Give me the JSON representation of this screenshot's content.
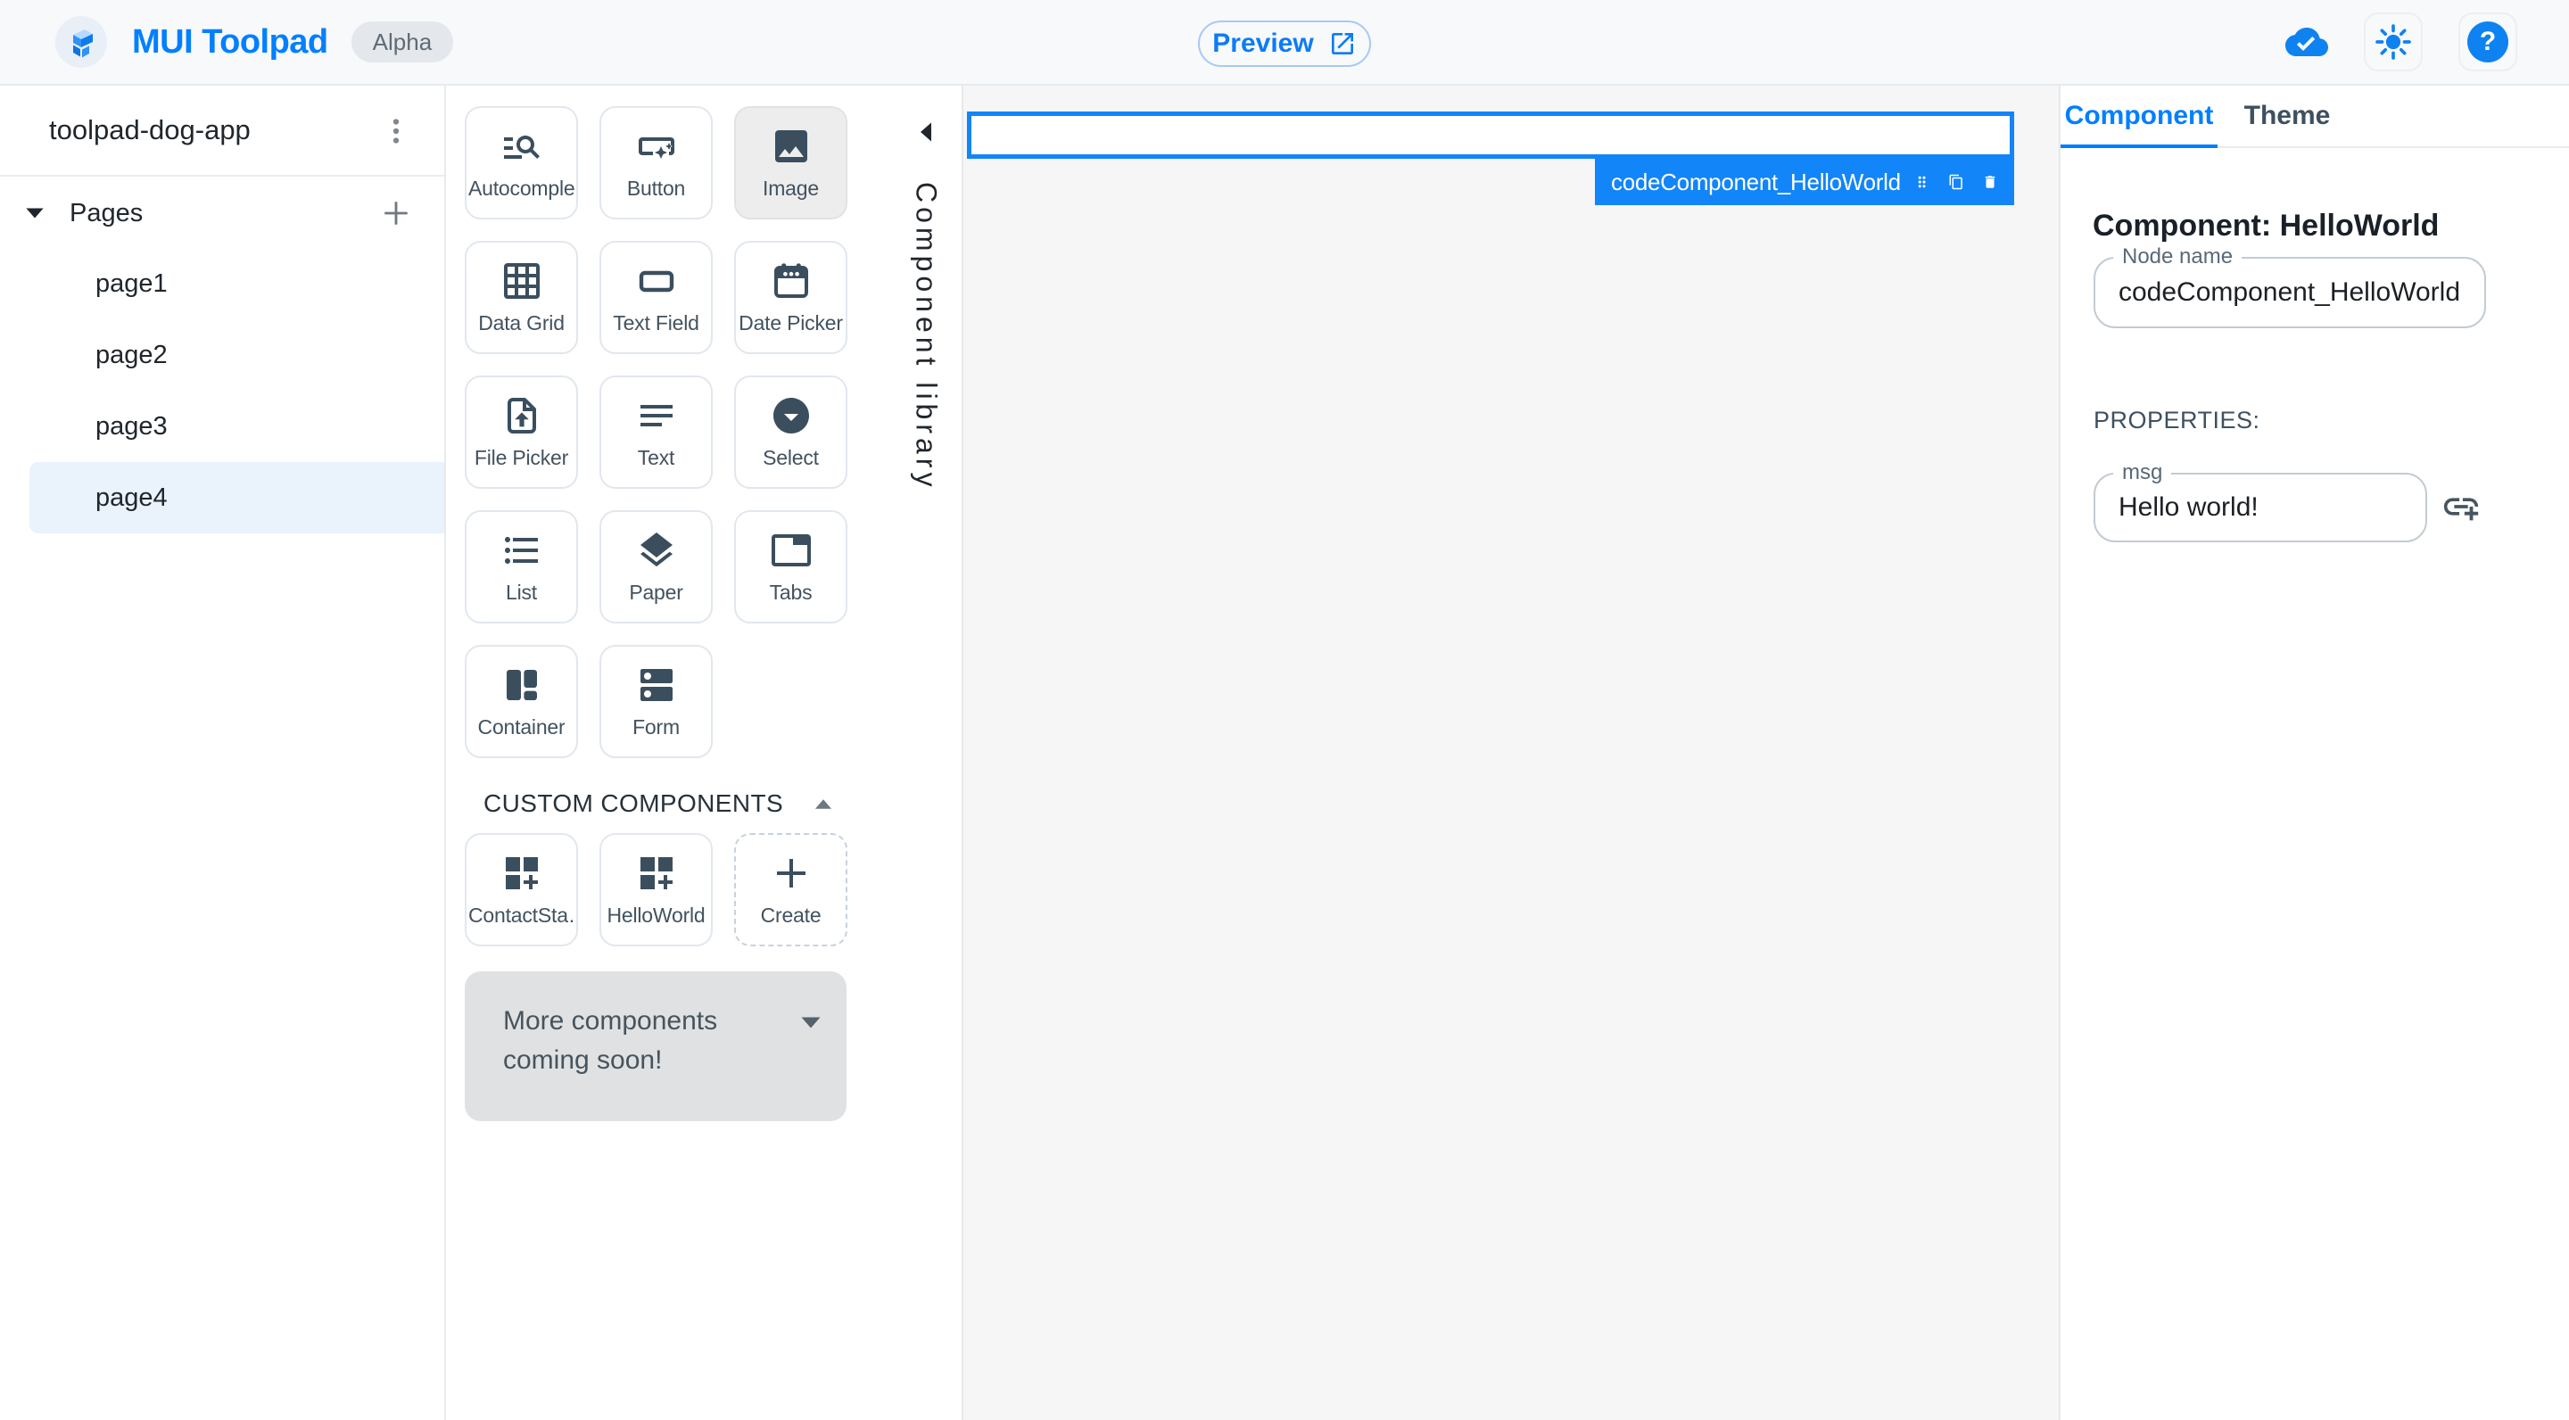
{
  "app_bar": {
    "logo_title": "MUI Toolpad",
    "badge": "Alpha",
    "preview_label": "Preview",
    "help_glyph": "?"
  },
  "sidebar": {
    "project_name": "toolpad-dog-app",
    "pages_header": "Pages",
    "pages": [
      {
        "label": "page1",
        "selected": false
      },
      {
        "label": "page2",
        "selected": false
      },
      {
        "label": "page3",
        "selected": false
      },
      {
        "label": "page4",
        "selected": true
      }
    ]
  },
  "library": {
    "vertical_title": "Component library",
    "components": [
      {
        "label": "Autocomplete",
        "icon": "manage-search-icon"
      },
      {
        "label": "Button",
        "icon": "smart-button-icon"
      },
      {
        "label": "Image",
        "icon": "image-icon",
        "selected": true
      },
      {
        "label": "Data Grid",
        "icon": "grid-icon"
      },
      {
        "label": "Text Field",
        "icon": "text-field-icon"
      },
      {
        "label": "Date Picker",
        "icon": "calendar-icon"
      },
      {
        "label": "File Picker",
        "icon": "upload-file-icon"
      },
      {
        "label": "Text",
        "icon": "notes-icon"
      },
      {
        "label": "Select",
        "icon": "dropdown-circle-icon"
      },
      {
        "label": "List",
        "icon": "list-bulleted-icon"
      },
      {
        "label": "Paper",
        "icon": "layers-icon"
      },
      {
        "label": "Tabs",
        "icon": "tab-icon"
      },
      {
        "label": "Container",
        "icon": "container-icon"
      },
      {
        "label": "Form",
        "icon": "dns-icon"
      }
    ],
    "custom_header": "CUSTOM COMPONENTS",
    "custom_components": [
      {
        "label": "ContactSta…",
        "icon": "dashboard-customize-icon"
      },
      {
        "label": "HelloWorld",
        "icon": "dashboard-customize-icon"
      }
    ],
    "create_label": "Create",
    "more_text": "More components coming soon!"
  },
  "canvas": {
    "selection_label": "codeComponent_HelloWorld"
  },
  "inspector": {
    "tab_component": "Component",
    "tab_theme": "Theme",
    "heading": "Component: HelloWorld",
    "node_name_label": "Node name",
    "node_name_value": "codeComponent_HelloWorld",
    "properties_header": "PROPERTIES:",
    "msg_label": "msg",
    "msg_value": "Hello world!"
  },
  "colors": {
    "accent": "#007FFF",
    "selection": "#1285F8",
    "icon_slate": "#3B4E5E",
    "canvas_bg": "#F6F6F7"
  }
}
